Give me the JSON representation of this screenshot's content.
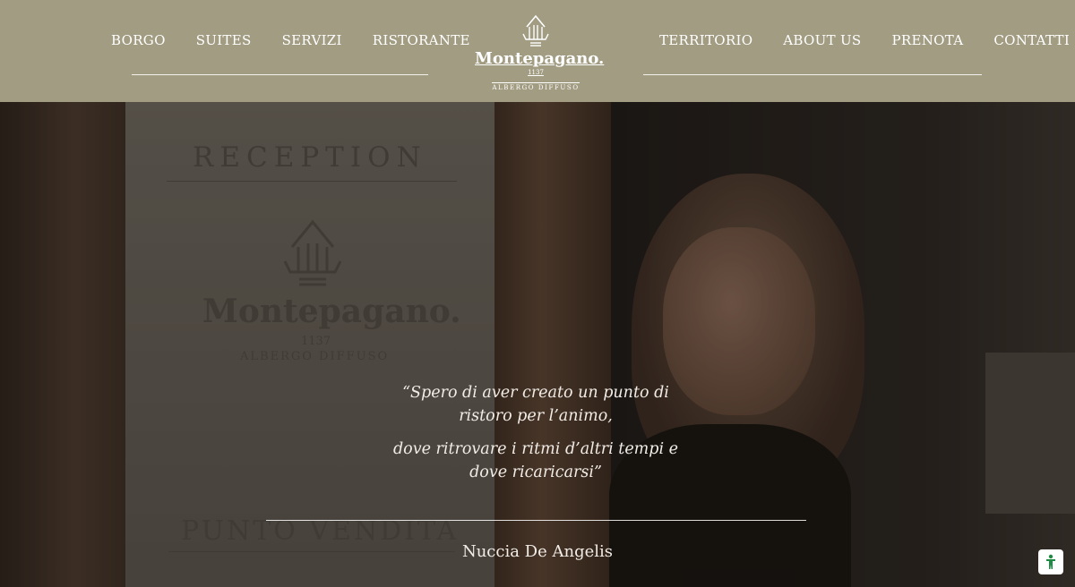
{
  "nav": {
    "left": [
      "BORGO",
      "SUITES",
      "SERVIZI",
      "RISTORANTE"
    ],
    "right": [
      "TERRITORIO",
      "ABOUT US",
      "PRENOTA",
      "CONTATTI"
    ]
  },
  "logo": {
    "name": "Montepagano.",
    "year": "1137",
    "subtitle": "ALBERGO DIFFUSO"
  },
  "background_sign": {
    "reception": "RECEPTION",
    "brand": "Montepagano.",
    "year": "1137",
    "subtitle": "ALBERGO DIFFUSO",
    "shop": "PUNTO VENDITA"
  },
  "quote": {
    "line1": "“Spero di aver creato un punto di ristoro per l’animo,",
    "line2": "dove ritrovare i ritmi d’altri tempi e dove ricaricarsi”",
    "author": "Nuccia De Angelis"
  },
  "colors": {
    "header_bg": "#a19c82",
    "text_light": "#ffffff",
    "accessibility_icon": "#1e8a43"
  },
  "icons": {
    "logo": "building-logo-icon",
    "accessibility": "accessibility-icon"
  }
}
